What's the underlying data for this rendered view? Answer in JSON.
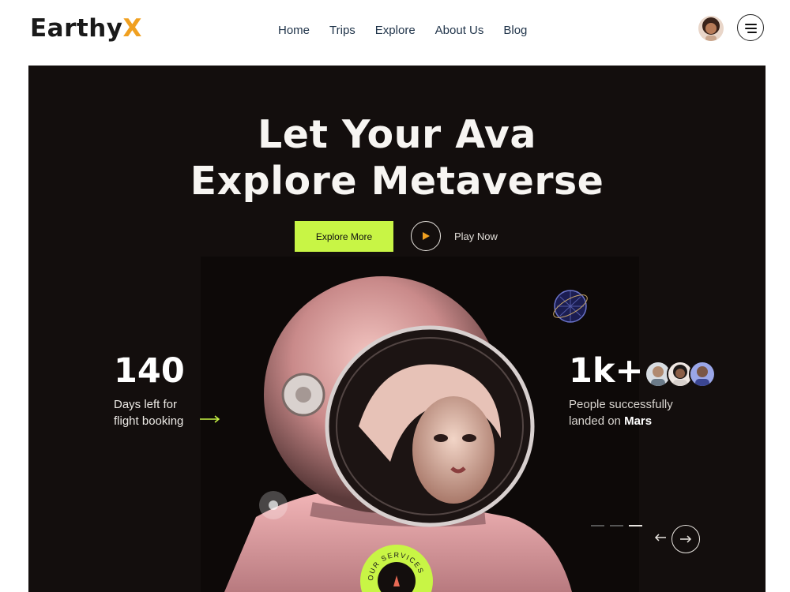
{
  "brand": {
    "name": "Earthy",
    "accent_letter": "X",
    "accent_color": "#f0a020"
  },
  "nav": {
    "items": [
      {
        "label": "Home"
      },
      {
        "label": "Trips"
      },
      {
        "label": "Explore"
      },
      {
        "label": "About Us"
      },
      {
        "label": "Blog"
      }
    ]
  },
  "header": {
    "avatar_icon": "user-avatar",
    "menu_icon": "hamburger-menu-icon"
  },
  "hero": {
    "title_line1": "Let Your Ava",
    "title_line2": "Explore Metaverse",
    "primary_button": "Explore More",
    "secondary_button": "Play Now",
    "accent_color": "#c8f545",
    "background_color": "#130e0d"
  },
  "stats": {
    "left": {
      "number": "140",
      "line1": "Days left for",
      "line2": "flight booking"
    },
    "right": {
      "number": "1k+",
      "line1": "People successfully",
      "line2_prefix": "landed on ",
      "line2_bold": "Mars"
    }
  },
  "badge": {
    "text": "OUR SERVICES"
  },
  "slider": {
    "total": 3,
    "active": 3
  }
}
